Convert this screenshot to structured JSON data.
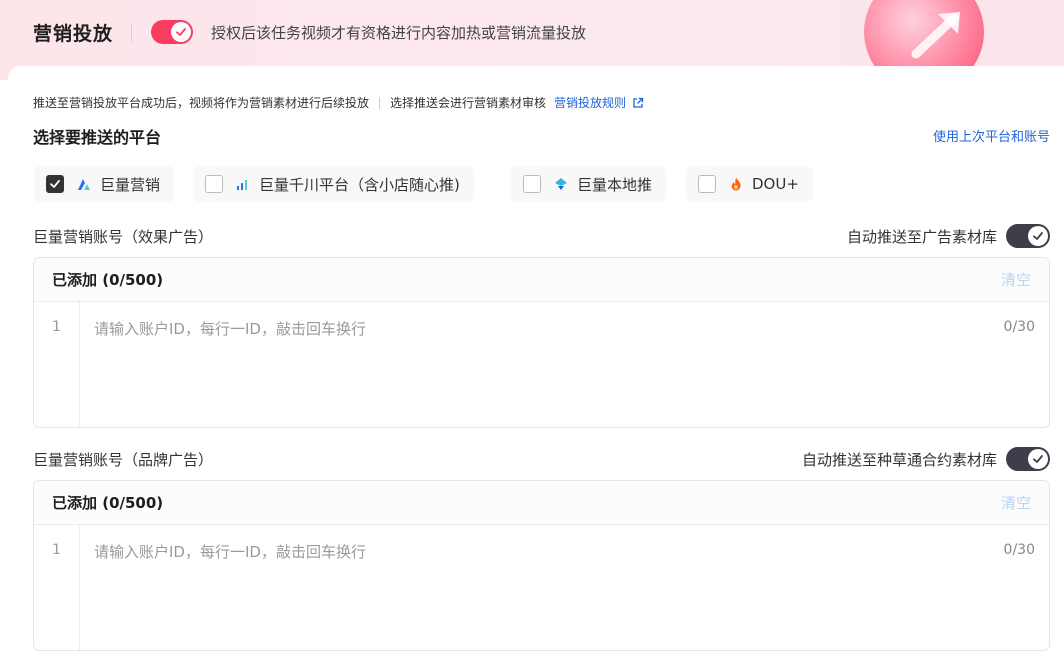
{
  "header": {
    "title": "营销投放",
    "toggle_on": true,
    "description": "授权后该任务视频才有资格进行内容加热或营销流量投放",
    "accent_color": "#fa3c5f"
  },
  "hint": {
    "text1": "推送至营销投放平台成功后，视频将作为营销素材进行后续投放",
    "text2": "选择推送会进行营销素材审核",
    "link": "营销投放规则",
    "link_icon": "external-link-icon"
  },
  "platforms": {
    "title": "选择要推送的平台",
    "reuse_link": "使用上次平台和账号",
    "items": [
      {
        "label": "巨量营销",
        "checked": true,
        "icon": "juliang-marketing-logo"
      },
      {
        "label": "巨量千川平台（含小店随心推)",
        "checked": false,
        "icon": "qianchuan-logo"
      },
      {
        "label": "巨量本地推",
        "checked": false,
        "icon": "local-push-logo"
      },
      {
        "label": "DOU+",
        "checked": false,
        "icon": "dou-plus-flame-logo"
      }
    ]
  },
  "accounts": [
    {
      "label": "巨量营销账号（效果广告）",
      "auto_label": "自动推送至广告素材库",
      "auto_on": true,
      "added": "已添加 (0/500)",
      "clear": "清空",
      "line_no": "1",
      "placeholder": "请输入账户ID，每行一ID，敲击回车换行",
      "counter": "0/30"
    },
    {
      "label": "巨量营销账号（品牌广告）",
      "auto_label": "自动推送至种草通合约素材库",
      "auto_on": true,
      "added": "已添加 (0/500)",
      "clear": "清空",
      "line_no": "1",
      "placeholder": "请输入账户ID，每行一ID，敲击回车换行",
      "counter": "0/30"
    }
  ],
  "colors": {
    "link": "#1e64d8",
    "toggle_dark": "#3f3d4a",
    "clear_disabled": "#b9d3f3"
  }
}
